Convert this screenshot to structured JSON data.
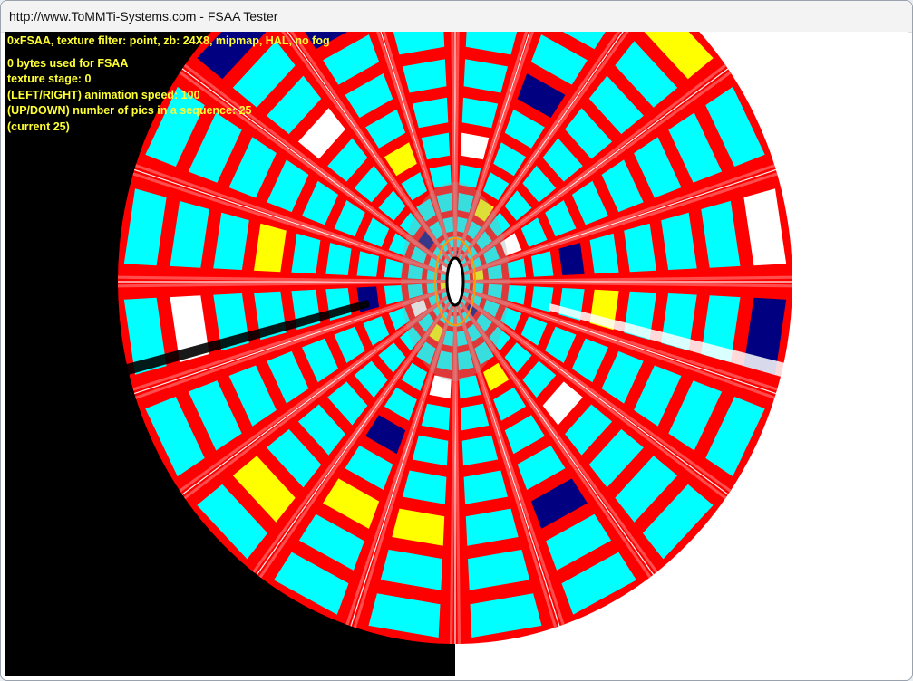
{
  "window": {
    "title": "http://www.ToMMTi-Systems.com - FSAA Tester"
  },
  "osd": {
    "line1": "0xFSAA, texture filter: point, zb: 24X8, mipmap, HAL, no fog",
    "line2": "0 bytes used for FSAA",
    "line3": "texture stage: 0",
    "line4": "(LEFT/RIGHT) animation speed: 100",
    "line5": "(UP/DOWN) number of pics in a sequence: 25",
    "line6": "(current 25)"
  },
  "colors": {
    "background_left": "#000000",
    "background_right": "#ffffff",
    "osd_text": "#ffff33",
    "red": "#ff0000",
    "cyan": "#00ffff",
    "yellow": "#ffff00",
    "navy": "#000080",
    "white": "#ffffff",
    "spoke": "#ff5050",
    "core_grey": "#a0a0a0"
  },
  "scene": {
    "type": "rendered-3d-tunnel",
    "spokes": 20,
    "rings": 11
  }
}
